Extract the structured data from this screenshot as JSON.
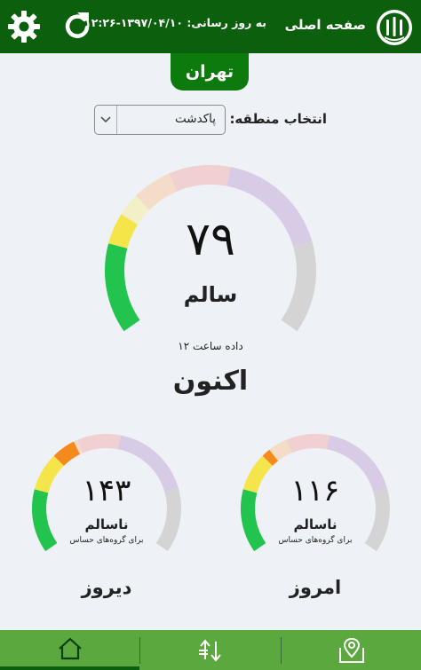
{
  "header": {
    "home_title": "صفحه اصلی",
    "updated_label": "به روز رسانی:",
    "updated_value": "۱۳۹۷/۰۴/۱۰-۱۲:۲۶",
    "background_color": "#0c5f0c"
  },
  "city": {
    "name": "تهران"
  },
  "region": {
    "label": "انتخاب منطقه:",
    "selected": "پاکدشت"
  },
  "current": {
    "aqi": "۷۹",
    "aqi_value": 79,
    "status": "سالم",
    "hour_label": "داده ساعت ۱۲",
    "period": "اکنون"
  },
  "today": {
    "aqi": "۱۱۶",
    "aqi_value": 116,
    "status": "ناسالم",
    "status_sub": "برای گروه‌های حساس",
    "period": "امروز"
  },
  "yesterday": {
    "aqi": "۱۴۳",
    "aqi_value": 143,
    "status": "ناسالم",
    "status_sub": "برای گروه‌های حساس",
    "period": "دیروز"
  },
  "gauge_colors": {
    "good": "#22c44e",
    "moderate": "#f5e54a",
    "sensitive": "#f58a1c",
    "unhealthy": "#ee3c3c",
    "very_unhealthy": "#a869c4",
    "hazardous": "#c0c0c0",
    "faded_good": "#b4e6bf",
    "faded_moderate": "#f2f0c6",
    "faded_sensitive": "#f4dcc8",
    "faded_unhealthy": "#f0d0d0",
    "faded_very_unhealthy": "#d8cbe6",
    "faded_hazardous": "#d4d4d4"
  },
  "nav": {
    "items": [
      {
        "icon": "home-icon",
        "active": true
      },
      {
        "icon": "sort-icon",
        "active": false
      },
      {
        "icon": "map-pin-icon",
        "active": false
      }
    ],
    "background_color": "#5aa83e"
  }
}
